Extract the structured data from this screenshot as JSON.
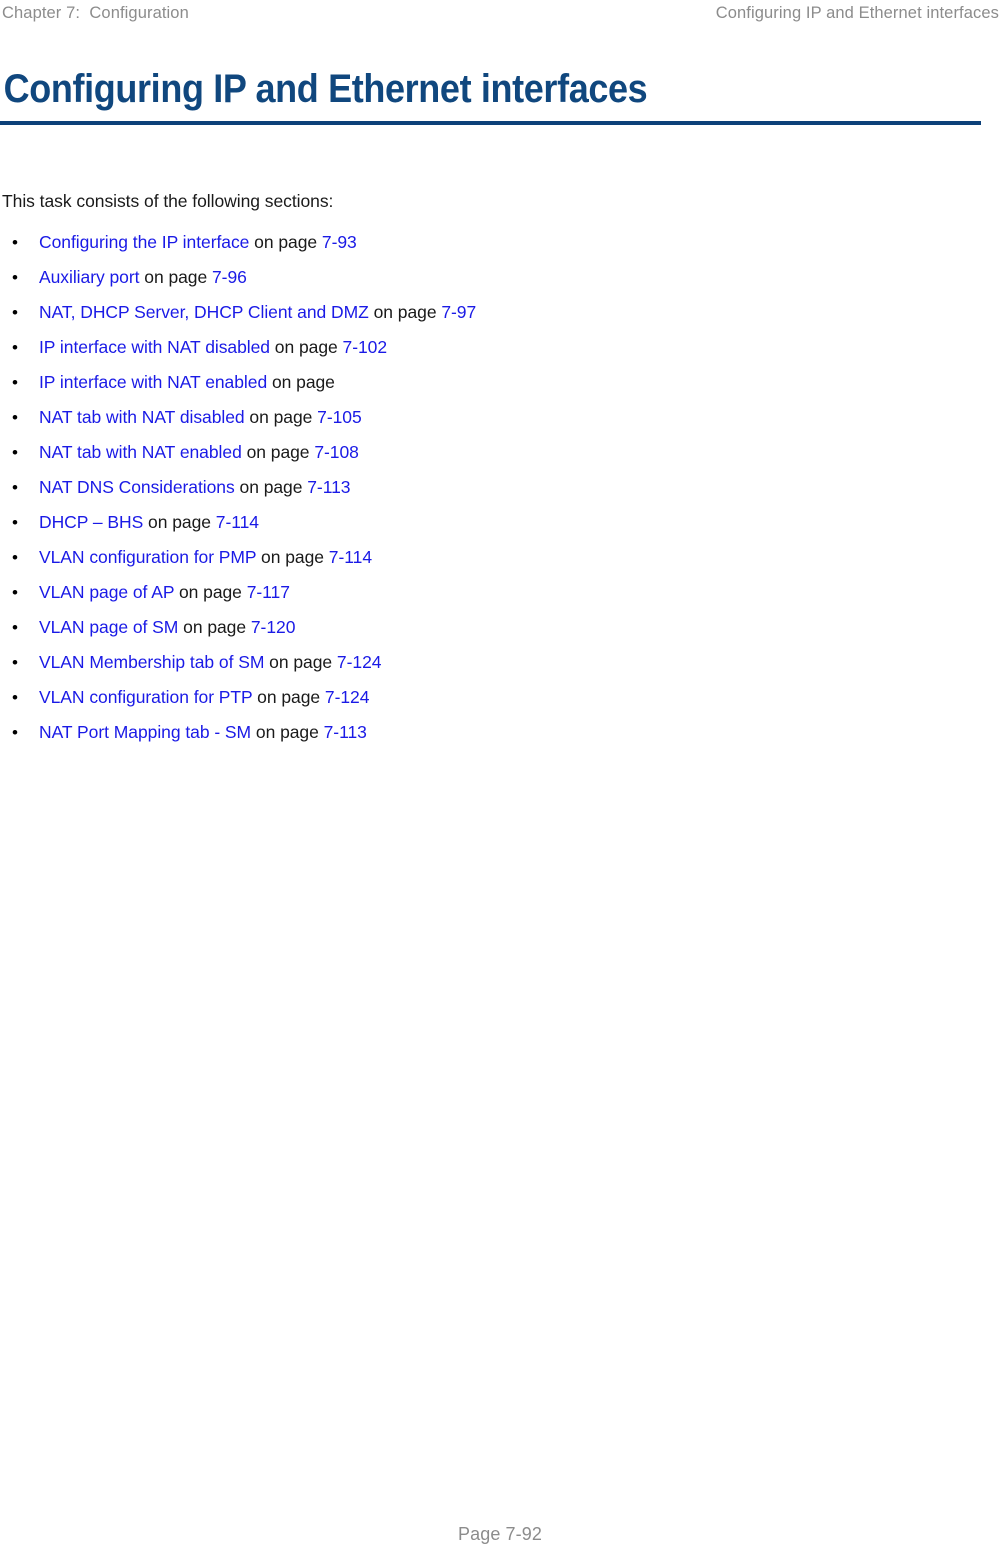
{
  "header": {
    "left": "Chapter 7:  Configuration",
    "right": "Configuring IP and Ethernet interfaces"
  },
  "title": {
    "text": "Configuring IP and Ethernet interfaces",
    "color": "#10477e",
    "rule_color": "#0d4179"
  },
  "body": {
    "intro": "This task consists of the following sections:",
    "bullet_glyph": "•",
    "link_color": "#1a1ae6",
    "text_color": "#1a1a1a",
    "items": [
      {
        "link": "Configuring the IP interface",
        "connector": " on page ",
        "page": "7-93"
      },
      {
        "link": "Auxiliary port",
        "connector": " on page ",
        "page": "7-96"
      },
      {
        "link": "NAT, DHCP Server, DHCP Client and DMZ",
        "connector": " on page ",
        "page": "7-97"
      },
      {
        "link": "IP interface with NAT disabled",
        "connector": " on page ",
        "page": "7-102"
      },
      {
        "link": "IP interface with NAT enabled",
        "connector": " on page",
        "page": ""
      },
      {
        "link": "NAT tab with NAT disabled",
        "connector": " on page ",
        "page": "7-105"
      },
      {
        "link": "NAT tab with NAT enabled",
        "connector": " on page ",
        "page": "7-108"
      },
      {
        "link": "NAT DNS Considerations",
        "connector": " on page ",
        "page": "7-113"
      },
      {
        "link": "DHCP – BHS",
        "connector": " on page ",
        "page": "7-114"
      },
      {
        "link": "VLAN configuration for PMP",
        "connector": " on page ",
        "page": "7-114"
      },
      {
        "link": "VLAN page of AP",
        "connector": " on page ",
        "page": "7-117"
      },
      {
        "link": "VLAN page of SM",
        "connector": " on page ",
        "page": "7-120"
      },
      {
        "link": "VLAN Membership tab of SM",
        "connector": " on page ",
        "page": "7-124"
      },
      {
        "link": "VLAN configuration for PTP",
        "connector": " on page ",
        "page": "7-124"
      },
      {
        "link": "NAT Port Mapping tab - SM",
        "connector": " on page ",
        "page": "7-113"
      }
    ]
  },
  "footer": {
    "page_label": "Page 7-92"
  }
}
